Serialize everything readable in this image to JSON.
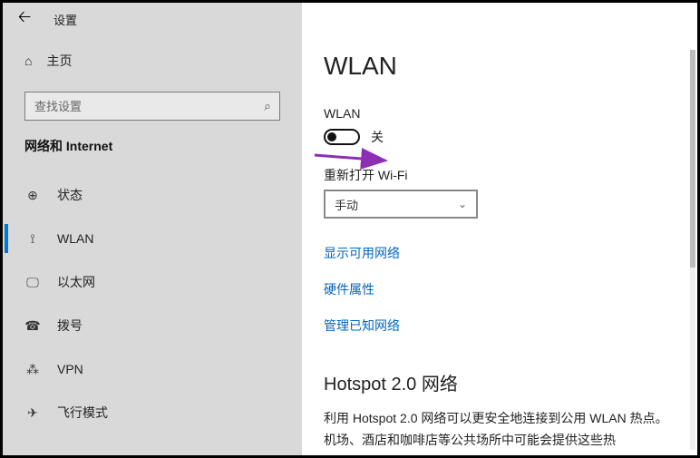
{
  "window": {
    "title": "设置"
  },
  "sidebar": {
    "home": "主页",
    "searchPlaceholder": "查找设置",
    "section": "网络和 Internet",
    "items": [
      {
        "icon": "globe-icon",
        "glyph": "⊕",
        "label": "状态"
      },
      {
        "icon": "wifi-icon",
        "glyph": "⟟",
        "label": "WLAN"
      },
      {
        "icon": "ethernet-icon",
        "glyph": "🖵",
        "label": "以太网"
      },
      {
        "icon": "dialup-icon",
        "glyph": "☎",
        "label": "拨号"
      },
      {
        "icon": "vpn-icon",
        "glyph": "⁂",
        "label": "VPN"
      },
      {
        "icon": "airplane-icon",
        "glyph": "✈",
        "label": "飞行模式"
      }
    ]
  },
  "content": {
    "heading": "WLAN",
    "wlanLabel": "WLAN",
    "toggleState": "关",
    "reopenLabel": "重新打开 Wi-Fi",
    "reopenValue": "手动",
    "links": {
      "showNetworks": "显示可用网络",
      "hardwareProps": "硬件属性",
      "manageKnown": "管理已知网络"
    },
    "hotspotHeading": "Hotspot 2.0 网络",
    "hotspotBody": "利用 Hotspot 2.0 网络可以更安全地连接到公用 WLAN 热点。机场、酒店和咖啡店等公共场所中可能会提供这些热"
  }
}
